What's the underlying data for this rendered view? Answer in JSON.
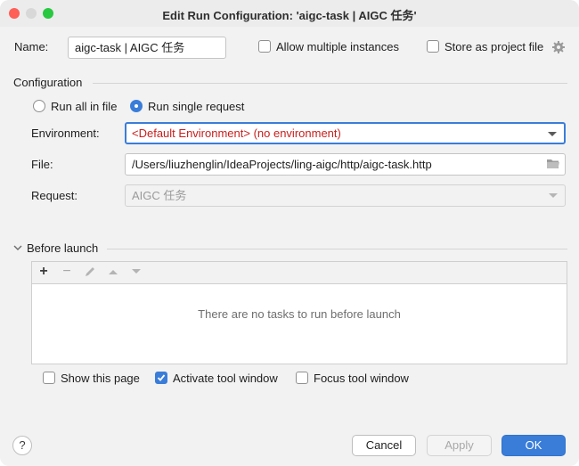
{
  "window": {
    "title": "Edit Run Configuration: 'aigc-task | AIGC 任务'"
  },
  "name_row": {
    "label": "Name:",
    "value": "aigc-task | AIGC 任务",
    "allow_multiple_label": "Allow multiple instances",
    "allow_multiple_checked": false,
    "store_project_label": "Store as project file",
    "store_project_checked": false
  },
  "configuration": {
    "heading": "Configuration",
    "run_all_label": "Run all in file",
    "run_single_label": "Run single request",
    "selected_mode": "Run single request",
    "environment_label": "Environment:",
    "environment_value": "<Default Environment> (no environment)",
    "file_label": "File:",
    "file_value": "/Users/liuzhenglin/IdeaProjects/ling-aigc/http/aigc-task.http",
    "request_label": "Request:",
    "request_value": "AIGC 任务"
  },
  "before_launch": {
    "heading": "Before launch",
    "toolbar": {
      "add": "+",
      "remove": "−"
    },
    "empty_text": "There are no tasks to run before launch",
    "show_page_label": "Show this page",
    "show_page_checked": false,
    "activate_tool_label": "Activate tool window",
    "activate_tool_checked": true,
    "focus_tool_label": "Focus tool window",
    "focus_tool_checked": false
  },
  "buttons": {
    "help": "?",
    "cancel": "Cancel",
    "apply": "Apply",
    "ok": "OK"
  },
  "colors": {
    "accent": "#3a7dd9",
    "error_text": "#c8201d",
    "window_bg": "#f2f2f2"
  },
  "icons": [
    "close-icon",
    "minimize-icon",
    "maximize-icon",
    "gear-icon",
    "folder-icon",
    "plus-icon",
    "minus-icon",
    "edit-icon",
    "move-up-icon",
    "move-down-icon",
    "help-icon",
    "checkmark-icon"
  ]
}
